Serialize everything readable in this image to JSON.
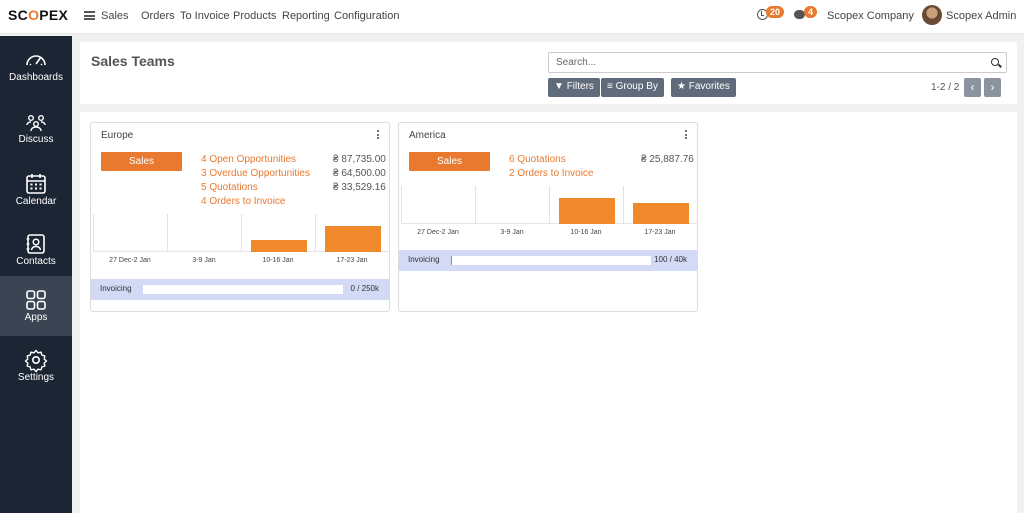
{
  "brand": {
    "logo_pre": "SC",
    "logo_x": "O",
    "logo_post": "PEX"
  },
  "nav": {
    "app": "Sales",
    "items": [
      "Orders",
      "To Invoice",
      "Products",
      "Reporting",
      "Configuration"
    ]
  },
  "topbar": {
    "activity_count": "20",
    "message_count": "4",
    "company": "Scopex Company",
    "user": "Scopex Admin"
  },
  "sidebar": {
    "items": [
      {
        "label": "Dashboards",
        "icon": "gauge-icon"
      },
      {
        "label": "Discuss",
        "icon": "people-icon"
      },
      {
        "label": "Calendar",
        "icon": "calendar-icon"
      },
      {
        "label": "Contacts",
        "icon": "contact-book-icon"
      },
      {
        "label": "Apps",
        "icon": "grid-icon",
        "active": true
      },
      {
        "label": "Settings",
        "icon": "gear-icon"
      }
    ]
  },
  "control": {
    "title": "Sales Teams",
    "search_placeholder": "Search...",
    "filters": "Filters",
    "group_by": "Group By",
    "favorites": "Favorites",
    "pager": "1-2 / 2"
  },
  "teams": [
    {
      "name": "Europe",
      "sales_button": "Sales",
      "links": [
        "4 Open Opportunities",
        "3 Overdue Opportunities",
        "5 Quotations",
        "4 Orders to Invoice"
      ],
      "amounts": [
        "₴ 87,735.00",
        "₴ 64,500.00",
        "₴ 33,529.16"
      ],
      "graph": {
        "weeks": [
          "27 Dec-2 Jan",
          "3-9 Jan",
          "10-16 Jan",
          "17-23 Jan"
        ],
        "relative_values": [
          0,
          0,
          0.45,
          1.0
        ]
      },
      "invoicing": {
        "label": "Invoicing",
        "value": "0 / 250k",
        "progress": 0
      }
    },
    {
      "name": "America",
      "sales_button": "Sales",
      "links": [
        "6 Quotations",
        "2 Orders to Invoice"
      ],
      "amounts": [
        "₴ 25,887.76"
      ],
      "graph": {
        "weeks": [
          "27 Dec-2 Jan",
          "3-9 Jan",
          "10-16 Jan",
          "17-23 Jan"
        ],
        "relative_values": [
          0,
          0,
          1.0,
          0.82
        ]
      },
      "invoicing": {
        "label": "Invoicing",
        "value": "100 / 40k",
        "progress": 0.0025
      }
    }
  ],
  "colors": {
    "accent": "#e8792f",
    "sidebar": "#1c2533",
    "sidebar_active": "#3a4453",
    "invoicing_bg": "#d3daf5"
  }
}
